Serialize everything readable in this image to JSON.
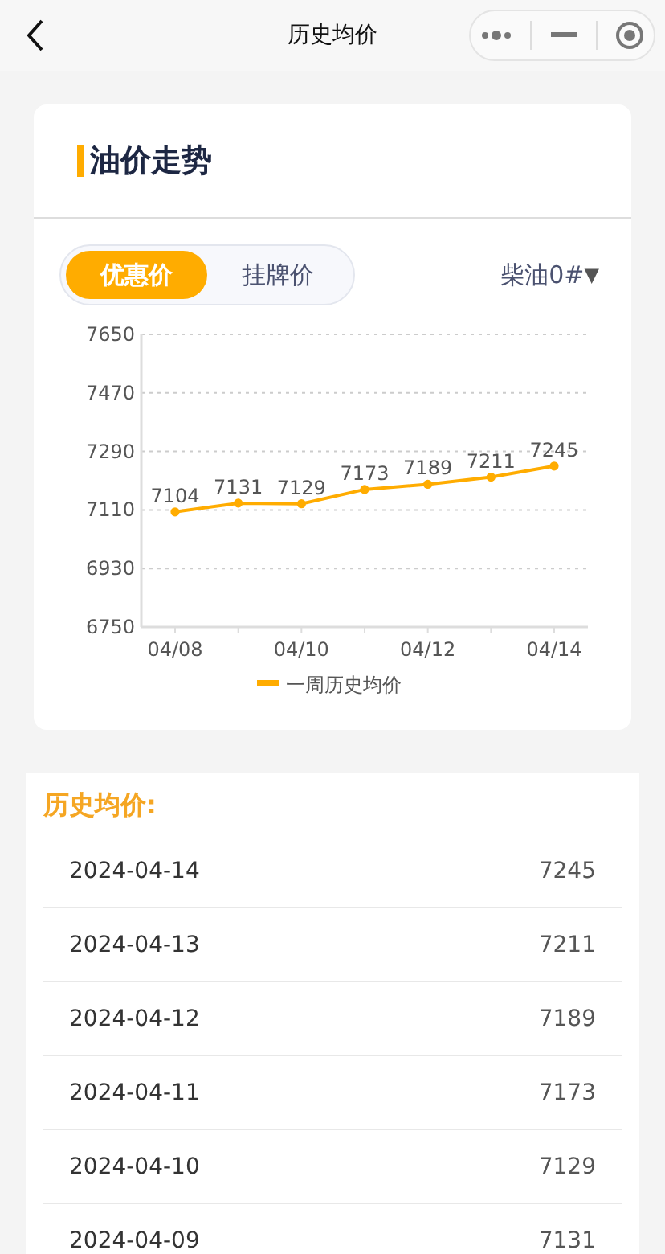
{
  "nav": {
    "title": "历史均价"
  },
  "trend_card": {
    "title": "油价走势",
    "tabs": [
      {
        "label": "优惠价",
        "selected": true
      },
      {
        "label": "挂牌价",
        "selected": false
      }
    ],
    "fuel_select": {
      "value": "柴油0#",
      "caret": "▼"
    },
    "chart_data": {
      "type": "line",
      "categories": [
        "04/08",
        null,
        "04/10",
        null,
        "04/12",
        null,
        "04/14"
      ],
      "ylim": [
        6750,
        7650
      ],
      "yticks": [
        6750,
        6930,
        7110,
        7290,
        7470,
        7650
      ],
      "data_labels": true,
      "grid": true,
      "series": [
        {
          "name": "一周历史均价",
          "color": "#ffac00",
          "marker": "circle",
          "values": [
            7104,
            7131,
            7129,
            7173,
            7189,
            7211,
            7245
          ]
        }
      ]
    }
  },
  "history": {
    "title": "历史均价:",
    "rows": [
      {
        "date": "2024-04-14",
        "price": "7245"
      },
      {
        "date": "2024-04-13",
        "price": "7211"
      },
      {
        "date": "2024-04-12",
        "price": "7189"
      },
      {
        "date": "2024-04-11",
        "price": "7173"
      },
      {
        "date": "2024-04-10",
        "price": "7129"
      },
      {
        "date": "2024-04-09",
        "price": "7131"
      }
    ]
  }
}
